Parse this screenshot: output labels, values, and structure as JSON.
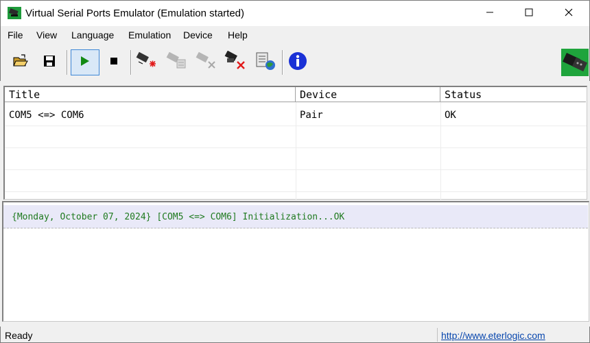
{
  "window": {
    "title": "Virtual Serial Ports Emulator (Emulation started)",
    "app_icon": "serial-port-device-icon",
    "controls": [
      "minimize-icon",
      "maximize-icon",
      "close-icon"
    ]
  },
  "menu": {
    "items": [
      "File",
      "View",
      "Language",
      "Emulation",
      "Device",
      "Help"
    ]
  },
  "toolbar": {
    "buttons": [
      {
        "icon": "open-folder-icon",
        "enabled": true
      },
      {
        "icon": "save-icon",
        "enabled": true
      },
      {
        "icon": "play-icon",
        "enabled": true,
        "pressed": true,
        "color": "#138a13"
      },
      {
        "icon": "stop-icon",
        "enabled": true
      },
      {
        "icon": "new-device-icon",
        "enabled": true
      },
      {
        "icon": "device-properties-icon",
        "enabled": false
      },
      {
        "icon": "remove-device-icon",
        "enabled": false
      },
      {
        "icon": "delete-device-icon",
        "enabled": true
      },
      {
        "icon": "settings-network-icon",
        "enabled": true
      },
      {
        "icon": "info-icon",
        "enabled": true,
        "color": "#1a31d6"
      }
    ],
    "brand_icon": "serial-connector-icon"
  },
  "device_list": {
    "columns": [
      "Title",
      "Device",
      "Status"
    ],
    "rows": [
      {
        "title": "COM5 <=> COM6",
        "device": "Pair",
        "status": "OK"
      }
    ]
  },
  "log": {
    "entries": [
      {
        "text": "{Monday, October 07, 2024} [COM5 <=> COM6] Initialization...OK",
        "color": "#1f7a1f"
      }
    ]
  },
  "status_bar": {
    "text": "Ready",
    "link": "http://www.eterlogic.com"
  }
}
